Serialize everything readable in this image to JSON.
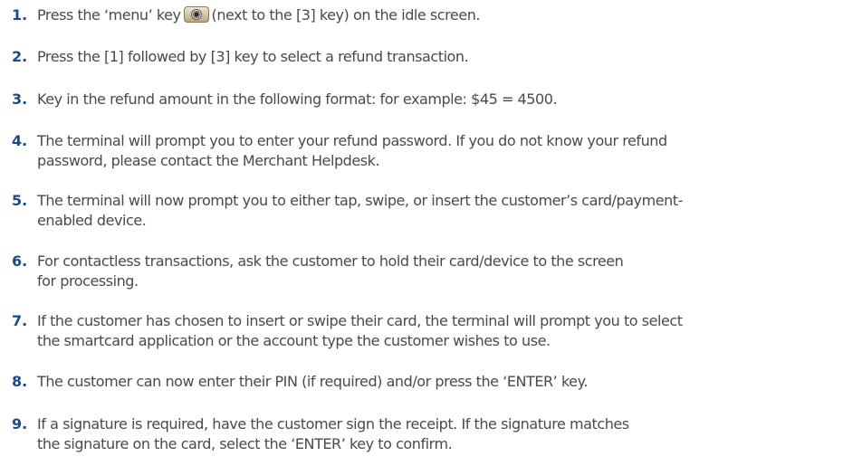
{
  "steps": [
    {
      "number": "1.",
      "lines": [
        "Press the ‘menu’ key",
        "(next to the [3] key) on the idle screen."
      ],
      "icon": "menu-key-icon"
    },
    {
      "number": "2.",
      "lines": [
        "Press the [1] followed by [3]  key to select a refund transaction."
      ]
    },
    {
      "number": "3.",
      "lines": [
        "Key in the refund amount in the following format: for example: $45 = 4500."
      ]
    },
    {
      "number": "4.",
      "lines": [
        "The terminal will prompt you to enter your refund password. If you do not know your refund",
        "password, please contact the Merchant Helpdesk."
      ]
    },
    {
      "number": "5.",
      "lines": [
        "The terminal will now prompt you to either tap, swipe, or insert the customer’s card/payment-",
        "enabled device."
      ]
    },
    {
      "number": "6.",
      "lines": [
        "For contactless transactions, ask the customer to hold their card/device to the screen",
        "for processing."
      ]
    },
    {
      "number": "7.",
      "lines": [
        "If the customer has chosen to insert or swipe their card, the terminal will prompt you to select",
        "the smartcard application or the account type the customer wishes to use."
      ]
    },
    {
      "number": "8.",
      "lines": [
        "The customer can now enter their PIN (if required) and/or press the ‘ENTER’ key."
      ]
    },
    {
      "number": "9.",
      "lines": [
        "If a signature is required, have the customer sign the receipt. If the signature matches",
        "the signature on the card, select the ‘ENTER’ key to confirm."
      ]
    }
  ]
}
